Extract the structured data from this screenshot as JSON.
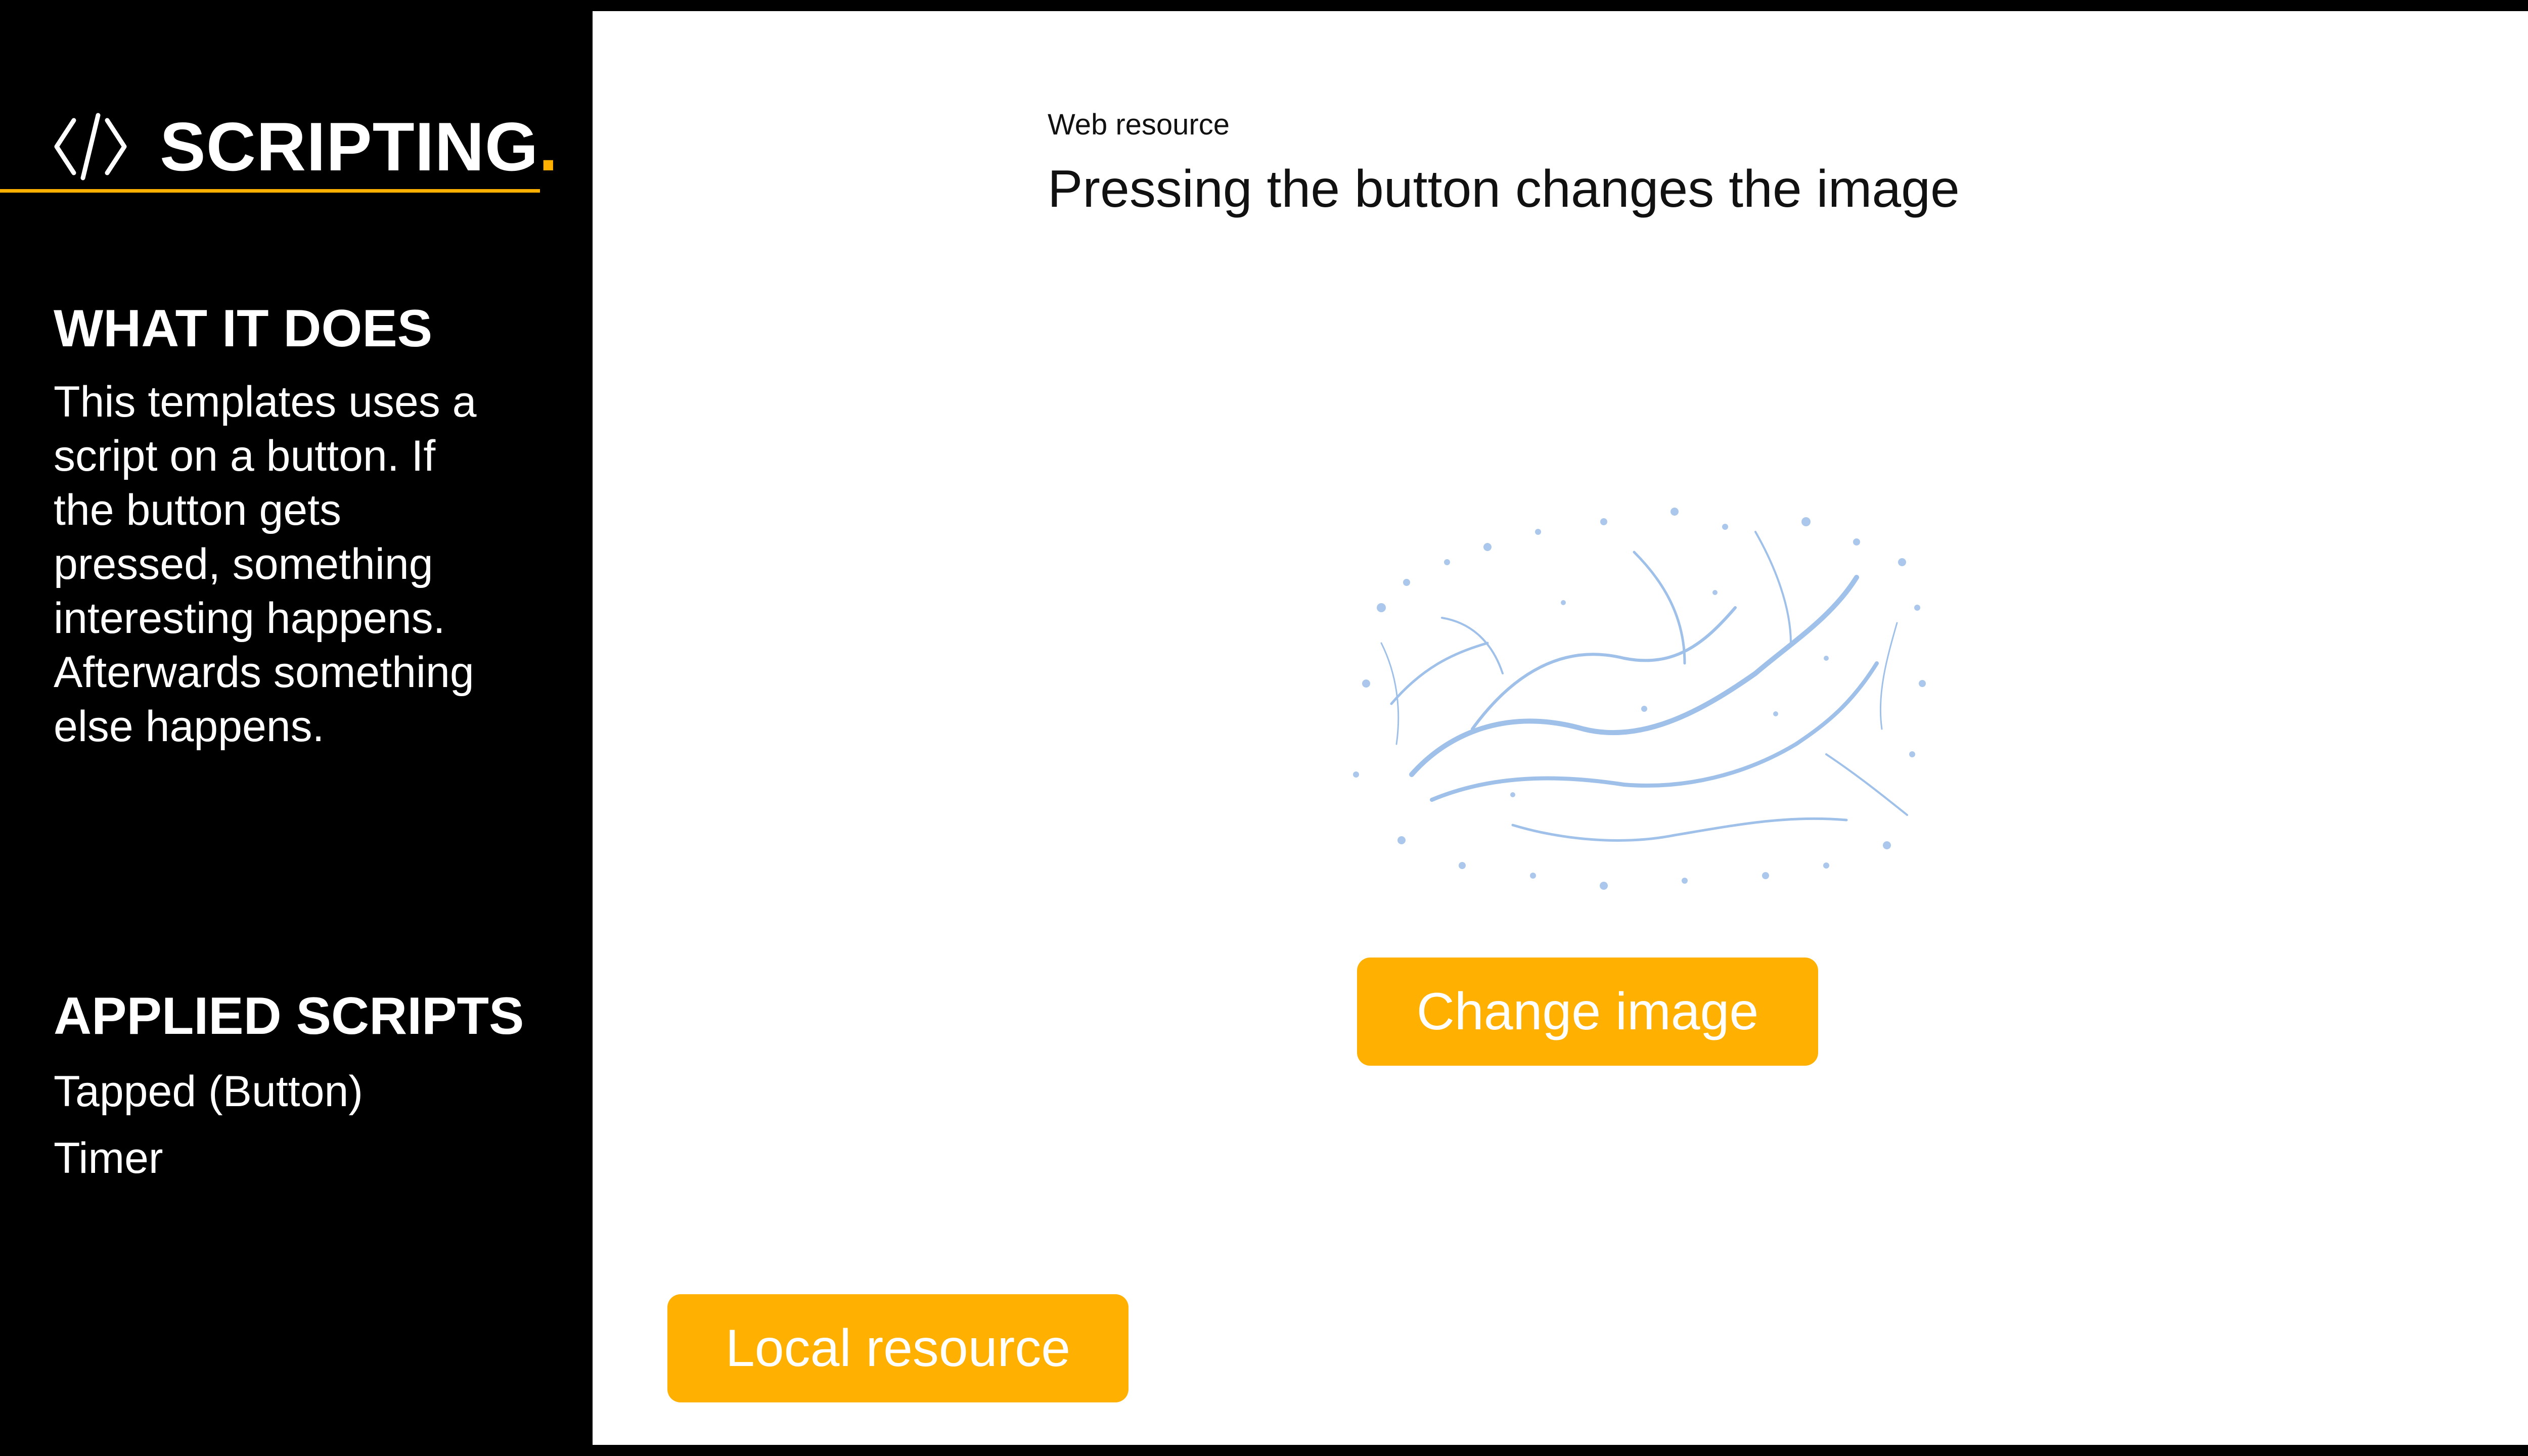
{
  "sidebar": {
    "brand": {
      "title": "SCRIPTING",
      "dot": ".",
      "icon": "code-brackets-icon"
    },
    "what_it_does": {
      "heading": "WHAT IT DOES",
      "lines": [
        "This templates uses a",
        "script on a button. If",
        "the button gets",
        "pressed, something",
        "interesting happens.",
        "Afterwards something",
        "else happens."
      ]
    },
    "applied_scripts": {
      "heading": "APPLIED SCRIPTS",
      "items": [
        "Tapped (Button)",
        "Timer"
      ]
    }
  },
  "main": {
    "label": "Web resource",
    "headline": "Pressing the button changes the image",
    "image": "water-splash-image",
    "change_button": "Change image",
    "local_button": "Local resource"
  },
  "colors": {
    "accent": "#FFB000",
    "sidebar_bg": "#000000",
    "panel_bg": "#FFFFFF",
    "splash": "#8FB6E6"
  }
}
